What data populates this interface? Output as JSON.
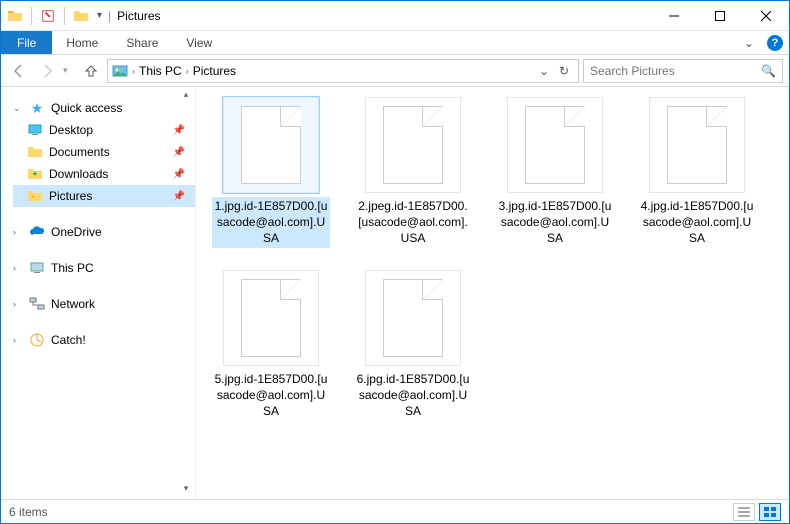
{
  "window": {
    "title": "Pictures",
    "min_tip": "Minimize",
    "max_tip": "Maximize",
    "close_tip": "Close"
  },
  "ribbon": {
    "file": "File",
    "tabs": [
      "Home",
      "Share",
      "View"
    ]
  },
  "address": {
    "crumbs": [
      "This PC",
      "Pictures"
    ],
    "search_placeholder": "Search Pictures"
  },
  "nav": {
    "quick_access": "Quick access",
    "quick_items": [
      {
        "label": "Desktop",
        "pinned": true
      },
      {
        "label": "Documents",
        "pinned": true
      },
      {
        "label": "Downloads",
        "pinned": true
      },
      {
        "label": "Pictures",
        "pinned": true,
        "selected": true
      }
    ],
    "onedrive": "OneDrive",
    "this_pc": "This PC",
    "network": "Network",
    "catch": "Catch!"
  },
  "files": [
    {
      "name": "1.jpg.id-1E857D00.[usacode@aol.com].USA",
      "selected": true
    },
    {
      "name": "2.jpeg.id-1E857D00.[usacode@aol.com].USA"
    },
    {
      "name": "3.jpg.id-1E857D00.[usacode@aol.com].USA"
    },
    {
      "name": "4.jpg.id-1E857D00.[usacode@aol.com].USA"
    },
    {
      "name": "5.jpg.id-1E857D00.[usacode@aol.com].USA"
    },
    {
      "name": "6.jpg.id-1E857D00.[usacode@aol.com].USA"
    }
  ],
  "status": {
    "count": "6 items"
  }
}
